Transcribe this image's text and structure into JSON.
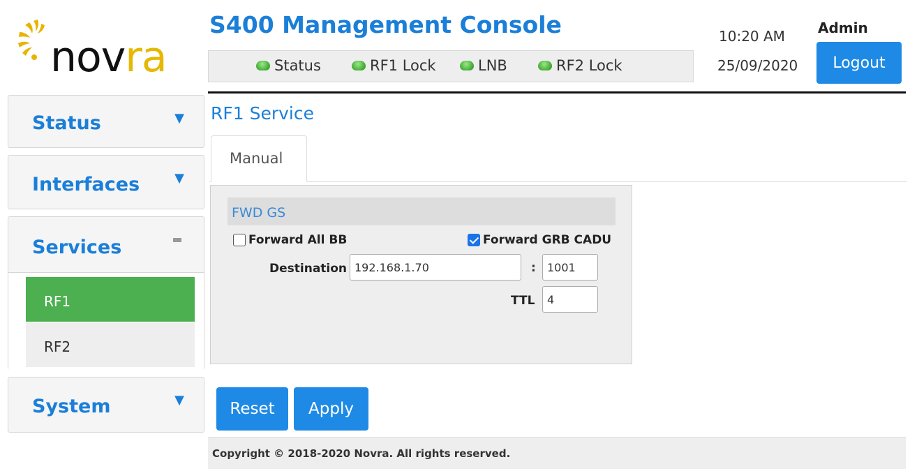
{
  "brand": {
    "logo_text_dark": "nov",
    "logo_text_accent": "ra",
    "accent_color": "#e6b800"
  },
  "header": {
    "title": "S400 Management Console",
    "indicators": [
      {
        "label": "Status",
        "state": "ok",
        "icon": "green-led-icon"
      },
      {
        "label": "RF1 Lock",
        "state": "ok",
        "icon": "green-led-icon"
      },
      {
        "label": "LNB",
        "state": "ok",
        "icon": "green-led-icon"
      },
      {
        "label": "RF2 Lock",
        "state": "ok",
        "icon": "green-led-icon"
      }
    ],
    "time": "10:20 AM",
    "date": "25/09/2020",
    "user": "Admin",
    "logout_label": "Logout"
  },
  "sidebar": {
    "sections": [
      {
        "label": "Status",
        "icon": "caret-down-icon"
      },
      {
        "label": "Interfaces",
        "icon": "caret-down-icon"
      },
      {
        "label": "Services",
        "icon": "minus-icon",
        "items": [
          {
            "label": "RF1",
            "active": true
          },
          {
            "label": "RF2",
            "active": false
          }
        ]
      },
      {
        "label": "System",
        "icon": "caret-down-icon"
      }
    ]
  },
  "main": {
    "page_title": "RF1 Service",
    "tabs": [
      {
        "label": "Manual",
        "active": true
      }
    ],
    "panel": {
      "heading": "FWD GS",
      "forward_all_bb": {
        "label": "Forward All BB",
        "checked": false
      },
      "forward_grb_cadu": {
        "label": "Forward GRB CADU",
        "checked": true
      },
      "destination_label": "Destination",
      "destination_ip": "192.168.1.70",
      "port_separator": ":",
      "port": "1001",
      "ttl_label": "TTL",
      "ttl": "4"
    },
    "buttons": {
      "reset": "Reset",
      "apply": "Apply"
    }
  },
  "footer": {
    "copyright": "Copyright © 2018-2020 Novra. All rights reserved."
  },
  "colors": {
    "primary": "#1e8ae6",
    "active_nav": "#4caf50",
    "status_ok": "#4cb33d"
  }
}
